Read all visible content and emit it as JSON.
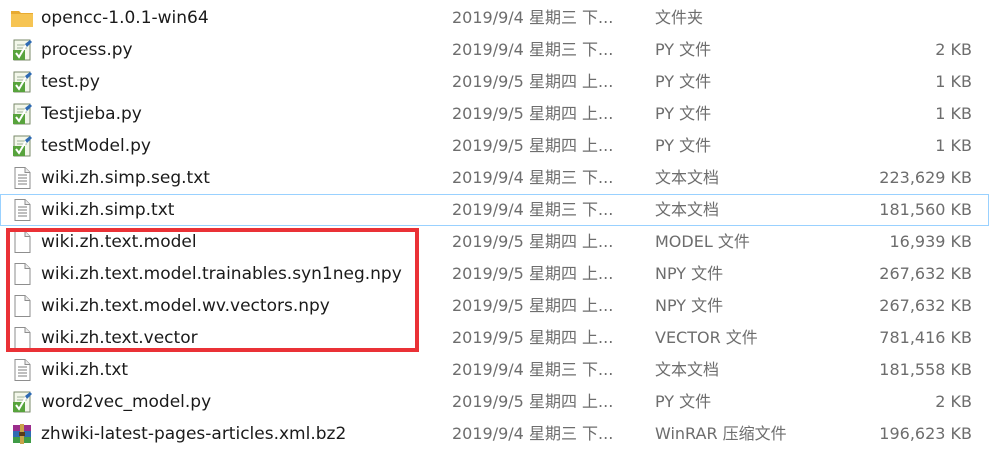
{
  "files": [
    {
      "name": "opencc-1.0.1-win64",
      "date": "2019/9/4 星期三 下...",
      "type": "文件夹",
      "size": "",
      "icon": "folder-icon"
    },
    {
      "name": "process.py",
      "date": "2019/9/4 星期三 下...",
      "type": "PY 文件",
      "size": "2 KB",
      "icon": "python-file-icon"
    },
    {
      "name": "test.py",
      "date": "2019/9/5 星期四 上...",
      "type": "PY 文件",
      "size": "1 KB",
      "icon": "python-file-icon"
    },
    {
      "name": "Testjieba.py",
      "date": "2019/9/5 星期四 上...",
      "type": "PY 文件",
      "size": "1 KB",
      "icon": "python-file-icon"
    },
    {
      "name": "testModel.py",
      "date": "2019/9/5 星期四 上...",
      "type": "PY 文件",
      "size": "1 KB",
      "icon": "python-file-icon"
    },
    {
      "name": "wiki.zh.simp.seg.txt",
      "date": "2019/9/4 星期三 下...",
      "type": "文本文档",
      "size": "223,629 KB",
      "icon": "text-file-icon"
    },
    {
      "name": "wiki.zh.simp.txt",
      "date": "2019/9/4 星期三 下...",
      "type": "文本文档",
      "size": "181,560 KB",
      "icon": "text-file-icon"
    },
    {
      "name": "wiki.zh.text.model",
      "date": "2019/9/5 星期四 上...",
      "type": "MODEL 文件",
      "size": "16,939 KB",
      "icon": "blank-file-icon"
    },
    {
      "name": "wiki.zh.text.model.trainables.syn1neg.npy",
      "date": "2019/9/5 星期四 上...",
      "type": "NPY 文件",
      "size": "267,632 KB",
      "icon": "blank-file-icon"
    },
    {
      "name": "wiki.zh.text.model.wv.vectors.npy",
      "date": "2019/9/5 星期四 上...",
      "type": "NPY 文件",
      "size": "267,632 KB",
      "icon": "blank-file-icon"
    },
    {
      "name": "wiki.zh.text.vector",
      "date": "2019/9/5 星期四 上...",
      "type": "VECTOR 文件",
      "size": "781,416 KB",
      "icon": "blank-file-icon"
    },
    {
      "name": "wiki.zh.txt",
      "date": "2019/9/4 星期三 下...",
      "type": "文本文档",
      "size": "181,558 KB",
      "icon": "text-file-icon"
    },
    {
      "name": "word2vec_model.py",
      "date": "2019/9/5 星期四 上...",
      "type": "PY 文件",
      "size": "2 KB",
      "icon": "python-file-icon"
    },
    {
      "name": "zhwiki-latest-pages-articles.xml.bz2",
      "date": "2019/9/4 星期三 下...",
      "type": "WinRAR 压缩文件",
      "size": "196,623 KB",
      "icon": "winrar-archive-icon"
    }
  ],
  "selected_file": "wiki.zh.simp.txt",
  "highlighted_files": [
    "wiki.zh.text.model",
    "wiki.zh.text.model.trainables.syn1neg.npy",
    "wiki.zh.text.model.wv.vectors.npy",
    "wiki.zh.text.vector"
  ],
  "colors": {
    "highlight_box": "#ea3136",
    "selection_border": "#99d1ff",
    "folder": "#f6c453",
    "name_text": "#1a1a1a",
    "detail_text": "#6d6d6d"
  }
}
